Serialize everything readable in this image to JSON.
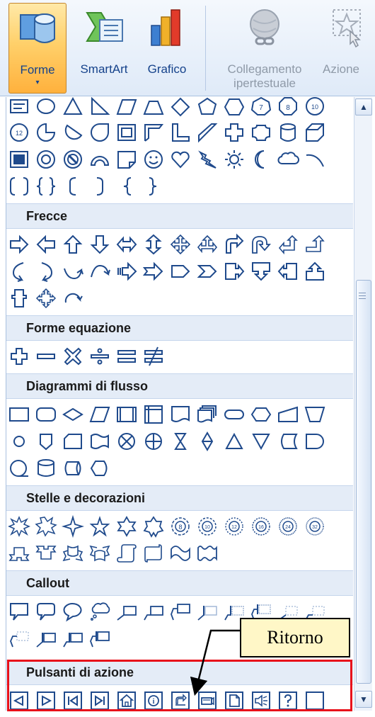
{
  "ribbon": {
    "buttons": [
      {
        "id": "forme",
        "label": "Forme",
        "icon": "shapes-icon",
        "active": true,
        "enabled": true
      },
      {
        "id": "smartart",
        "label": "SmartArt",
        "icon": "smartart-icon",
        "active": false,
        "enabled": true
      },
      {
        "id": "grafico",
        "label": "Grafico",
        "icon": "chart-icon",
        "active": false,
        "enabled": true
      },
      {
        "id": "collegamento",
        "label": "Collegamento",
        "label2": "ipertestuale",
        "icon": "hyperlink-icon",
        "active": false,
        "enabled": false
      },
      {
        "id": "azione",
        "label": "Azione",
        "icon": "action-icon",
        "active": false,
        "enabled": false
      }
    ],
    "dropdown_glyph": "▾"
  },
  "gallery": {
    "sections": [
      {
        "id": "frecce",
        "title": "Frecce"
      },
      {
        "id": "forme-equazione",
        "title": "Forme equazione"
      },
      {
        "id": "diagrammi-di-flusso",
        "title": "Diagrammi di flusso"
      },
      {
        "id": "stelle-e-decorazioni",
        "title": "Stelle e decorazioni"
      },
      {
        "id": "callout",
        "title": "Callout"
      },
      {
        "id": "pulsanti-di-azione",
        "title": "Pulsanti di azione"
      }
    ],
    "action_buttons": [
      "action-back-icon",
      "action-forward-icon",
      "action-beginning-icon",
      "action-end-icon",
      "action-home-icon",
      "action-information-icon",
      "action-return-icon",
      "action-movie-icon",
      "action-document-icon",
      "action-sound-icon",
      "action-help-icon",
      "action-custom-icon"
    ]
  },
  "scrollbar": {
    "up_glyph": "▲",
    "down_glyph": "▼"
  },
  "annotation": {
    "callout_text": "Ritorno",
    "highlight_color": "#e8101a",
    "callout_fill": "#fff7c7"
  },
  "colors": {
    "ribbon_active": "#ffd06a",
    "section_header": "#e4ecf7",
    "shape_stroke": "#1f4a8c",
    "ribbon_text": "#15428b"
  }
}
